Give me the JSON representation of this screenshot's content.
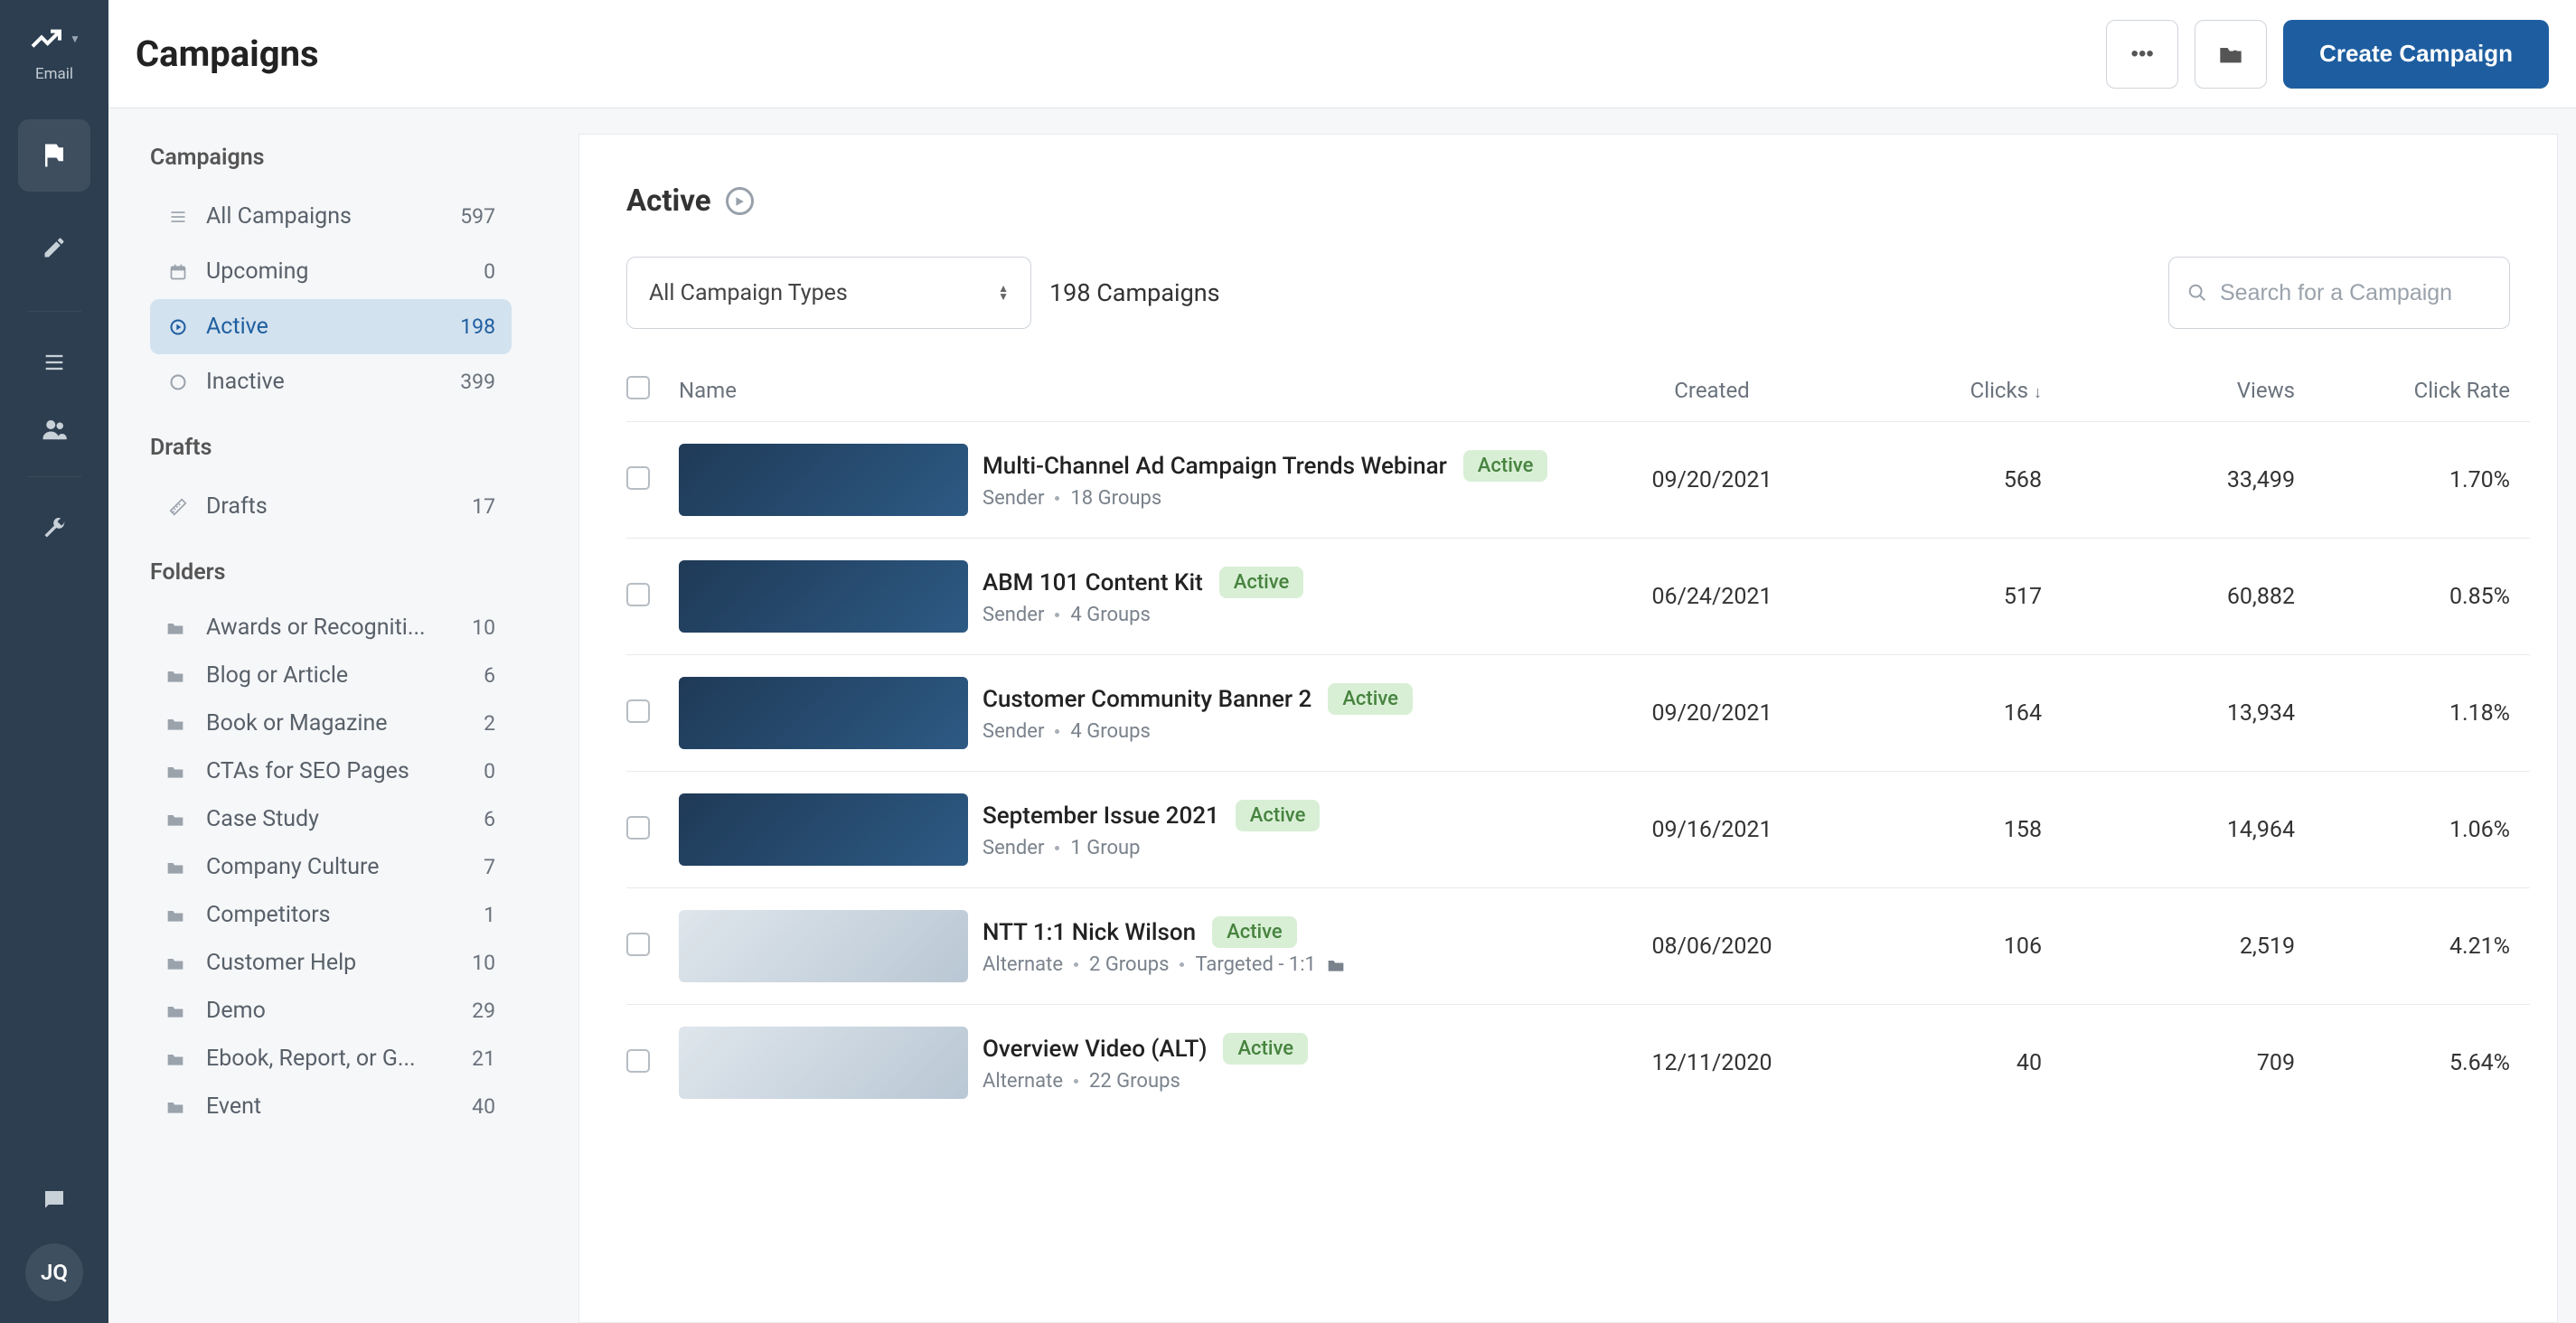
{
  "brand": {
    "label": "Email"
  },
  "user": {
    "initials": "JQ"
  },
  "header": {
    "title": "Campaigns",
    "create_label": "Create Campaign"
  },
  "sidebar": {
    "sections": {
      "campaigns_title": "Campaigns",
      "drafts_title": "Drafts",
      "folders_title": "Folders"
    },
    "campaigns": [
      {
        "icon": "list",
        "label": "All Campaigns",
        "count": "597"
      },
      {
        "icon": "calendar",
        "label": "Upcoming",
        "count": "0"
      },
      {
        "icon": "play",
        "label": "Active",
        "count": "198",
        "active": true
      },
      {
        "icon": "circle",
        "label": "Inactive",
        "count": "399"
      }
    ],
    "drafts": [
      {
        "icon": "ruler",
        "label": "Drafts",
        "count": "17"
      }
    ],
    "folders": [
      {
        "label": "Awards or Recogniti...",
        "count": "10"
      },
      {
        "label": "Blog or Article",
        "count": "6"
      },
      {
        "label": "Book or Magazine",
        "count": "2"
      },
      {
        "label": "CTAs for SEO Pages",
        "count": "0"
      },
      {
        "label": "Case Study",
        "count": "6"
      },
      {
        "label": "Company Culture",
        "count": "7"
      },
      {
        "label": "Competitors",
        "count": "1"
      },
      {
        "label": "Customer Help",
        "count": "10"
      },
      {
        "label": "Demo",
        "count": "29"
      },
      {
        "label": "Ebook, Report, or G...",
        "count": "21"
      },
      {
        "label": "Event",
        "count": "40"
      }
    ]
  },
  "content": {
    "title": "Active",
    "filter_select": "All Campaign Types",
    "count_label": "198 Campaigns",
    "search_placeholder": "Search for a Campaign",
    "columns": {
      "name": "Name",
      "created": "Created",
      "clicks": "Clicks",
      "views": "Views",
      "rate": "Click Rate"
    },
    "sort_indicator": "↓",
    "status_pill": "Active",
    "rows": [
      {
        "title": "Multi-Channel Ad Campaign Trends Webinar",
        "subA": "Sender",
        "subB": "18 Groups",
        "created": "09/20/2021",
        "clicks": "568",
        "views": "33,499",
        "rate": "1.70%"
      },
      {
        "title": "ABM 101 Content Kit",
        "subA": "Sender",
        "subB": "4 Groups",
        "created": "06/24/2021",
        "clicks": "517",
        "views": "60,882",
        "rate": "0.85%"
      },
      {
        "title": "Customer Community Banner 2",
        "subA": "Sender",
        "subB": "4 Groups",
        "created": "09/20/2021",
        "clicks": "164",
        "views": "13,934",
        "rate": "1.18%"
      },
      {
        "title": "September Issue 2021",
        "subA": "Sender",
        "subB": "1 Group",
        "created": "09/16/2021",
        "clicks": "158",
        "views": "14,964",
        "rate": "1.06%"
      },
      {
        "title": "NTT 1:1 Nick Wilson",
        "subA": "Alternate",
        "subB": "2 Groups",
        "subC": "Targeted - 1:1",
        "hasFolder": true,
        "thumbAlt": true,
        "created": "08/06/2020",
        "clicks": "106",
        "views": "2,519",
        "rate": "4.21%"
      },
      {
        "title": "Overview Video (ALT)",
        "subA": "Alternate",
        "subB": "22 Groups",
        "thumbAlt": true,
        "created": "12/11/2020",
        "clicks": "40",
        "views": "709",
        "rate": "5.64%"
      }
    ]
  }
}
